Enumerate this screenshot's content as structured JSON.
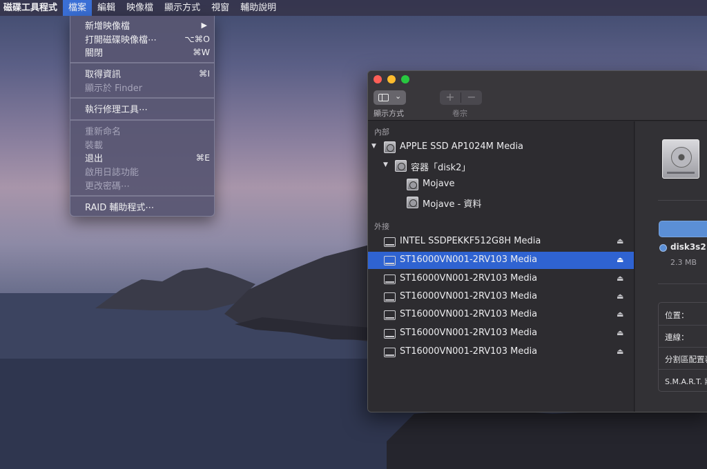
{
  "menubar": {
    "app_name": "磁碟工具程式",
    "items": [
      "檔案",
      "編輯",
      "映像檔",
      "顯示方式",
      "視窗",
      "輔助說明"
    ]
  },
  "file_menu": {
    "new_image": "新增映像檔",
    "new_image_arrow": "▶",
    "open_image": "打開磁碟映像檔⋯",
    "open_image_shortcut": "⌥⌘O",
    "close": "關閉",
    "close_shortcut": "⌘W",
    "get_info": "取得資訊",
    "get_info_shortcut": "⌘I",
    "show_in_finder": "顯示於 Finder",
    "first_aid": "執行修理工具⋯",
    "rename": "重新命名",
    "mount": "裝載",
    "eject": "退出",
    "eject_shortcut": "⌘E",
    "enable_journaling": "啟用日誌功能",
    "change_password": "更改密碼⋯",
    "raid": "RAID 輔助程式⋯"
  },
  "toolbar": {
    "view_label": "顯示方式",
    "volume_label": "卷宗",
    "add": "+",
    "remove": "−"
  },
  "sidebar": {
    "internal_header": "內部",
    "external_header": "外接",
    "internal_disk": "APPLE SSD AP1024M Media",
    "container": "容器「disk2」",
    "volumes": [
      "Mojave",
      "Mojave - 資料"
    ],
    "external": [
      "INTEL SSDPEKKF512G8H Media",
      "ST16000VN001-2RV103 Media",
      "ST16000VN001-2RV103 Media",
      "ST16000VN001-2RV103 Media",
      "ST16000VN001-2RV103 Media",
      "ST16000VN001-2RV103 Media",
      "ST16000VN001-2RV103 Media"
    ],
    "selected_index": 1
  },
  "detail": {
    "partition_name": "disk3s2",
    "partition_size": "2.3 MB",
    "info_labels": [
      "位置：",
      "連線：",
      "分割區配置表",
      "S.M.A.R.T. 狀"
    ]
  },
  "colors": {
    "accent": "#2f63d1",
    "partition": "#5b8fd6"
  }
}
